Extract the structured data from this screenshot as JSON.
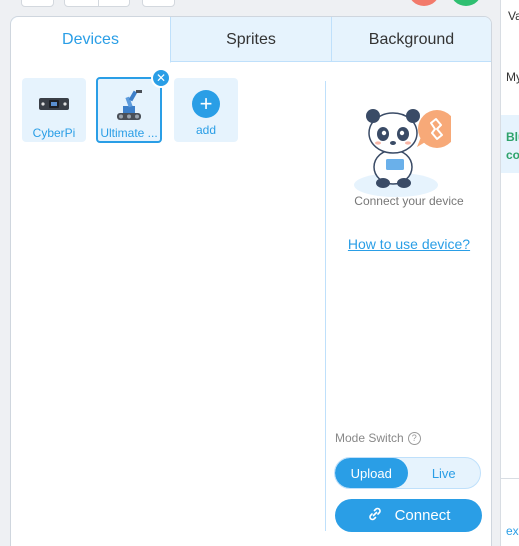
{
  "tabs": [
    {
      "label": "Devices"
    },
    {
      "label": "Sprites"
    },
    {
      "label": "Background"
    }
  ],
  "devices": [
    {
      "label": "CyberPi",
      "icon": "cyberpi-board-icon"
    },
    {
      "label": "Ultimate ...",
      "icon": "robot-arm-icon",
      "selected": true
    },
    {
      "label": "add",
      "icon": "plus-icon"
    }
  ],
  "connect_panel": {
    "hint": "Connect your device",
    "howto_link": "How to use device?",
    "mode_switch_label": "Mode Switch",
    "mode_options": [
      "Upload",
      "Live"
    ],
    "mode_selected": "Upload",
    "connect_label": "Connect"
  },
  "side_strip": {
    "t1": "Va",
    "t2": "My",
    "t3": "Blu",
    "t4": "co",
    "t5": "ex"
  },
  "colors": {
    "accent": "#2a9ee6",
    "tab_bg": "#e6f3fd",
    "stop": "#f27a6b",
    "go": "#2fbf71",
    "side_green": "#2fa36b"
  }
}
